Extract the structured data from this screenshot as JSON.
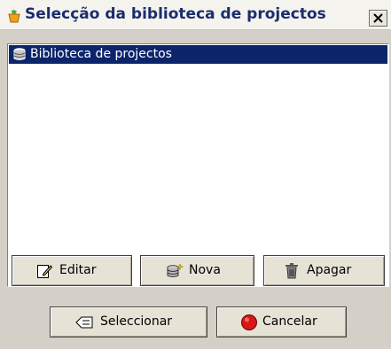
{
  "window": {
    "title": "Selecção da biblioteca de projectos"
  },
  "list": {
    "items": [
      {
        "label": "Biblioteca de projectos",
        "selected": true,
        "icon": "database-icon"
      }
    ]
  },
  "buttons": {
    "edit": {
      "label": "Editar",
      "icon": "edit-pencil-icon"
    },
    "new": {
      "label": "Nova",
      "icon": "new-database-icon"
    },
    "delete": {
      "label": "Apagar",
      "icon": "trash-icon"
    },
    "select": {
      "label": "Seleccionar",
      "icon": "select-arrow-icon"
    },
    "cancel": {
      "label": "Cancelar",
      "icon": "stop-icon"
    }
  },
  "colors": {
    "title_text": "#1b2c6e",
    "selection": "#0b246a",
    "dialog_bg": "#d4d0c8"
  }
}
